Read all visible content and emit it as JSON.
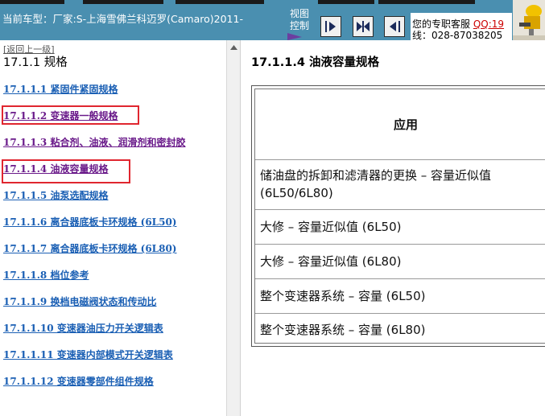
{
  "header": {
    "vehicle_label": "当前车型：厂家:S-上海雪佛兰科迈罗(Camaro)2011-",
    "view_control_line1": "视图",
    "view_control_line2": "控制",
    "service_label": "您的专职客服",
    "qq_label": "QQ:19",
    "phone_label": "线：028-87038205"
  },
  "toc": {
    "back_label": "[返回上一级]",
    "heading": "17.1.1 规格",
    "items": [
      {
        "label": "17.1.1.1 紧固件紧固规格"
      },
      {
        "label": "17.1.1.2 变速器一般规格"
      },
      {
        "label": "17.1.1.3 粘合剂、油液、润滑剂和密封胶"
      },
      {
        "label": "17.1.1.4 油液容量规格"
      },
      {
        "label": "17.1.1.5 油泵选配规格"
      },
      {
        "label": "17.1.1.6 离合器底板卡环规格 (6L50)"
      },
      {
        "label": "17.1.1.7 离合器底板卡环规格 (6L80)"
      },
      {
        "label": "17.1.1.8 档位参考"
      },
      {
        "label": "17.1.1.9 换档电磁阀状态和传动比"
      },
      {
        "label": "17.1.1.10 变速器油压力开关逻辑表"
      },
      {
        "label": "17.1.1.11 变速器内部模式开关逻辑表"
      },
      {
        "label": "17.1.1.12 变速器零部件组件规格"
      }
    ]
  },
  "content": {
    "title": "17.1.1.4 油液容量规格",
    "table": {
      "header": "应用",
      "rows": [
        {
          "line1": "储油盘的拆卸和滤清器的更换 – 容量近似值",
          "line2": "(6L50/6L80)"
        },
        {
          "line1": "大修 – 容量近似值 (6L50)",
          "line2": ""
        },
        {
          "line1": "大修 – 容量近似值 (6L80)",
          "line2": ""
        },
        {
          "line1": "整个变速器系统 – 容量 (6L50)",
          "line2": ""
        },
        {
          "line1": "整个变速器系统 – 容量 (6L80)",
          "line2": ""
        }
      ]
    }
  },
  "colors": {
    "topbar": "#4a8fb0",
    "link": "#1a5fb4",
    "visited_link": "#6a1a8a",
    "highlight_box": "#e0262f"
  },
  "icons": [
    "next-page-icon",
    "fit-width-icon",
    "previous-page-icon",
    "logo-figure-icon",
    "scroll-up-arrow-icon"
  ]
}
